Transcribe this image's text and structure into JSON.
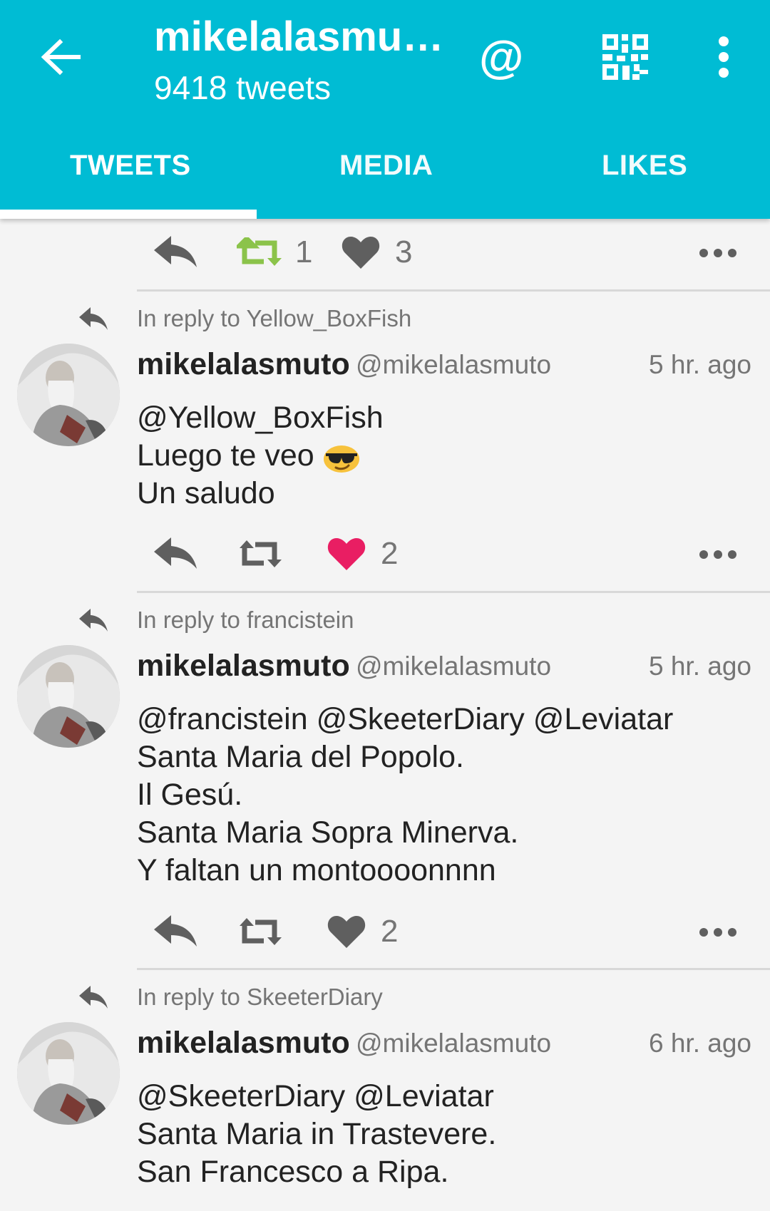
{
  "appbar": {
    "title": "mikelalasmu…",
    "subtitle": "9418 tweets",
    "mention_symbol": "@",
    "color": "#00bcd4"
  },
  "tabs": [
    {
      "label": "TWEETS",
      "active": true
    },
    {
      "label": "MEDIA",
      "active": false
    },
    {
      "label": "LIKES",
      "active": false
    }
  ],
  "top_actions": {
    "retweet_count": "1",
    "like_count": "3"
  },
  "tweets": [
    {
      "reply_to": "In reply to Yellow_BoxFish",
      "name": "mikelalasmuto",
      "handle": "@mikelalasmuto",
      "time": "5 hr. ago",
      "lines": [
        "@Yellow_BoxFish",
        "Luego te veo",
        "Un saludo"
      ],
      "emoji": "smiling-face-with-sunglasses",
      "like_count": "2",
      "liked": true
    },
    {
      "reply_to": "In reply to francistein",
      "name": "mikelalasmuto",
      "handle": "@mikelalasmuto",
      "time": "5 hr. ago",
      "lines": [
        "@francistein @SkeeterDiary @Leviatar",
        "Santa Maria del Popolo.",
        "Il Gesú.",
        "Santa Maria Sopra Minerva.",
        "Y faltan un montoooonnnn"
      ],
      "like_count": "2",
      "liked": false
    },
    {
      "reply_to": "In reply to SkeeterDiary",
      "name": "mikelalasmuto",
      "handle": "@mikelalasmuto",
      "time": "6 hr. ago",
      "lines": [
        "@SkeeterDiary @Leviatar",
        "Santa Maria in Trastevere.",
        "San Francesco a Ripa."
      ]
    }
  ],
  "colors": {
    "retweet_active": "#8bc34a",
    "like_active": "#e91e63",
    "icon_gray": "#5f5f5f"
  }
}
